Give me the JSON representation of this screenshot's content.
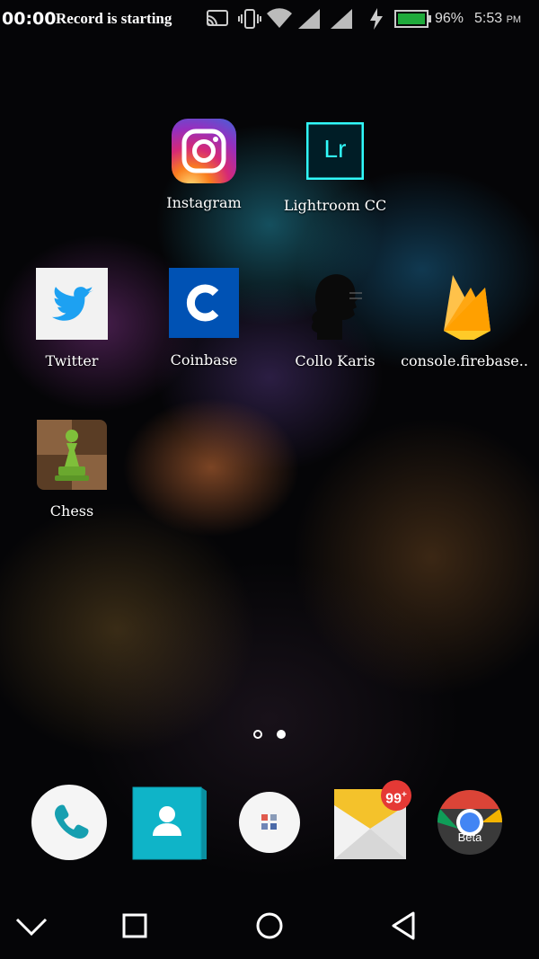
{
  "status_bar": {
    "record_timer": "00:00",
    "record_text": "Record is starting",
    "battery_percent": "96%",
    "time": "5:53",
    "time_suffix": "PM"
  },
  "apps": {
    "instagram": "Instagram",
    "lightroom": "Lightroom CC",
    "lightroom_logo": "Lr",
    "twitter": "Twitter",
    "coinbase": "Coinbase",
    "collo": "Collo Karis",
    "firebase": "console.firebase..",
    "chess": "Chess"
  },
  "pager": {
    "pages": 2,
    "current": 2
  },
  "dock": {
    "email_badge": "99",
    "email_badge_plus": "+",
    "chrome_label": "Beta"
  },
  "colors": {
    "instagram_gradient": [
      "#feda75",
      "#fa7e1e",
      "#d62976",
      "#962fbf",
      "#4f5bd5"
    ],
    "lightroom_bg": "#001d26",
    "lightroom_accent": "#31fbfb",
    "twitter_blue": "#1da1f2",
    "coinbase_blue": "#0052b4",
    "firebase_orange": "#ffa000",
    "contacts_teal": "#0fb4c8",
    "email_yellow": "#f4c22b",
    "email_badge_red": "#e53935"
  }
}
